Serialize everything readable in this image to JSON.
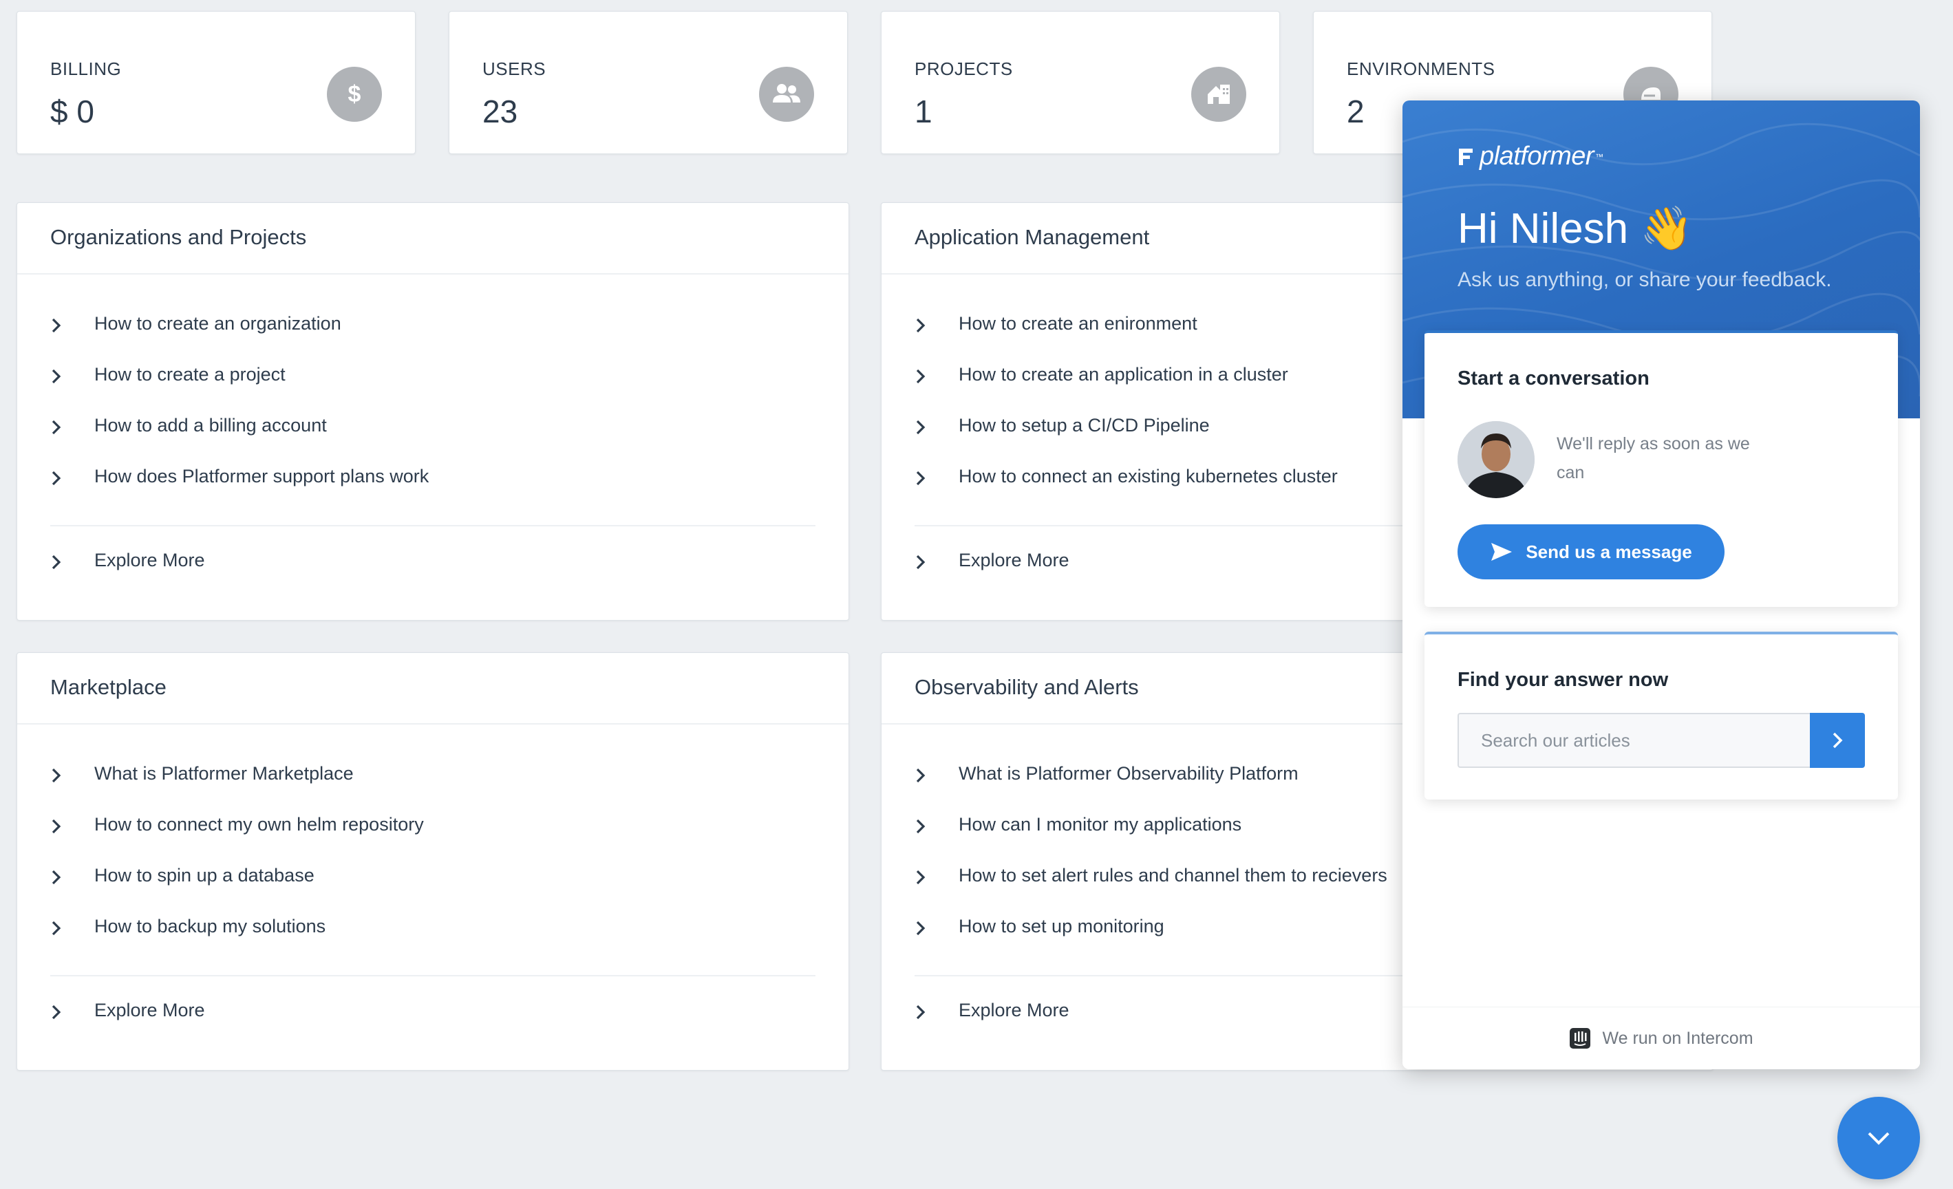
{
  "stats": [
    {
      "label": "BILLING",
      "value": "$ 0",
      "icon": "dollar-icon"
    },
    {
      "label": "USERS",
      "value": "23",
      "icon": "users-icon"
    },
    {
      "label": "PROJECTS",
      "value": "1",
      "icon": "building-icon"
    },
    {
      "label": "ENVIRONMENTS",
      "value": "2",
      "icon": "environment-icon"
    }
  ],
  "panels": {
    "organizations": {
      "title": "Organizations and Projects",
      "items": [
        "How to create an organization",
        "How to create a project",
        "How to add a billing account",
        "How does Platformer support plans work"
      ],
      "more": "Explore More"
    },
    "application": {
      "title": "Application Management",
      "items": [
        "How to create an enironment",
        "How to create an application in a cluster",
        "How to setup a CI/CD Pipeline",
        "How to connect an existing kubernetes cluster"
      ],
      "more": "Explore More"
    },
    "marketplace": {
      "title": "Marketplace",
      "items": [
        "What is Platformer Marketplace",
        "How to connect my own helm repository",
        "How to spin up a database",
        "How to backup my solutions"
      ],
      "more": "Explore More"
    },
    "observability": {
      "title": "Observability and Alerts",
      "items": [
        "What is Platformer Observability Platform",
        "How can I monitor my applications",
        "How to set alert rules and channel them to recievers",
        "How to set up monitoring"
      ],
      "more": "Explore More"
    }
  },
  "widget": {
    "brand": "platformer",
    "brand_tm": "™",
    "greeting": "Hi Nilesh 👋",
    "subtitle": "Ask us anything, or share your feedback.",
    "conversation": {
      "title": "Start a conversation",
      "reply_text": "We'll reply as soon as we can",
      "button": "Send us a message"
    },
    "find": {
      "title": "Find your answer now",
      "placeholder": "Search our articles"
    },
    "footer": "We run on Intercom"
  },
  "colors": {
    "accent": "#2f82e0",
    "header_blue": "#2b6cc0",
    "background": "#eceff2",
    "icon_grey": "#b0b3b7"
  }
}
